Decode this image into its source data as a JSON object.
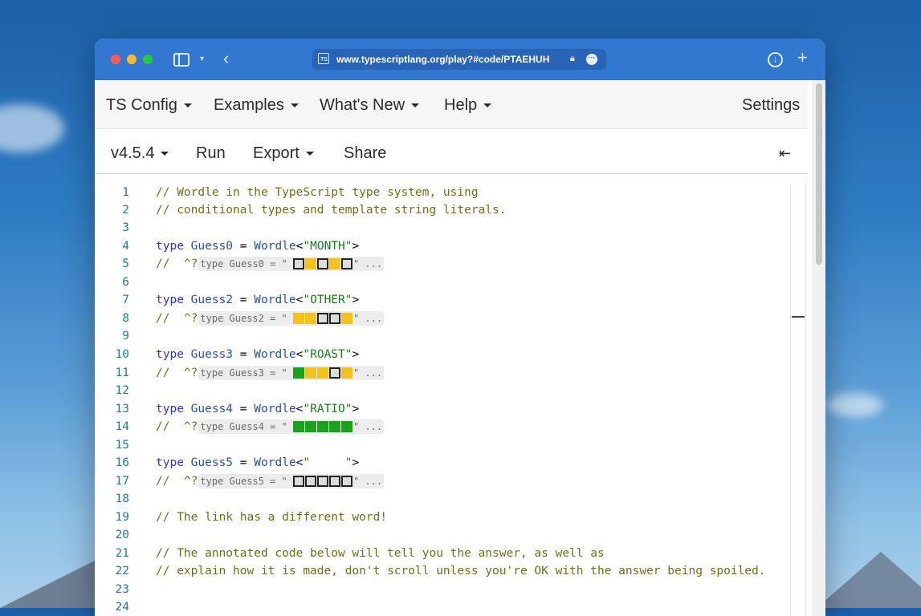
{
  "browser": {
    "url": "www.typescriptlang.org/play?#code/PTAEHUH",
    "favicon_text": "TS",
    "icons": [
      "sidebar-icon",
      "chevron-down-icon",
      "back-icon",
      "lock-icon",
      "more-icon",
      "download-icon",
      "plus-icon"
    ]
  },
  "menu": {
    "ts_config": "TS Config",
    "examples": "Examples",
    "whats_new": "What's New",
    "help": "Help",
    "settings": "Settings"
  },
  "toolbar": {
    "version": "v4.5.4",
    "run": "Run",
    "export": "Export",
    "share": "Share",
    "collapse_glyph": "⇤"
  },
  "colors": {
    "titlebar": "#3378d0",
    "comment": "#67711c",
    "keyword": "#2a34cc",
    "string": "#1d7a1d",
    "square_yellow": "#f4c21f",
    "square_green": "#1aa31a"
  },
  "code": {
    "l1": "// Wordle in the TypeScript type system, using",
    "l2": "// conditional types and template string literals.",
    "type_kw": "type",
    "eq": " = ",
    "wordle": "Wordle",
    "hint_prefix": "//  ^?",
    "hint_quote": "\"",
    "hint_tail": "\" ...",
    "g0_name": "Guess0",
    "g0_word": "\"MONTH\"",
    "g0_hint": "type Guess0 = \" ",
    "g0_squares": [
      "grey",
      "yellow",
      "grey",
      "yellow",
      "grey"
    ],
    "g2_name": "Guess2",
    "g2_word": "\"OTHER\"",
    "g2_hint": "type Guess2 = \" ",
    "g2_squares": [
      "yellow",
      "yellow",
      "grey",
      "grey",
      "yellow"
    ],
    "g3_name": "Guess3",
    "g3_word": "\"ROAST\"",
    "g3_hint": "type Guess3 = \" ",
    "g3_squares": [
      "green",
      "yellow",
      "yellow",
      "grey",
      "yellow"
    ],
    "g4_name": "Guess4",
    "g4_word": "\"RATIO\"",
    "g4_hint": "type Guess4 = \" ",
    "g4_squares": [
      "green",
      "green",
      "green",
      "green",
      "green"
    ],
    "g5_name": "Guess5",
    "g5_word": "\"     \"",
    "g5_hint": "type Guess5 = \" ",
    "g5_squares": [
      "grey",
      "grey",
      "grey",
      "grey",
      "grey"
    ],
    "l19": "// The link has a different word!",
    "l21": "// The annotated code below will tell you the answer, as well as",
    "l22": "// explain how it is made, don't scroll unless you're OK with the answer being spoiled."
  },
  "line_numbers": [
    "1",
    "2",
    "3",
    "4",
    "5",
    "6",
    "7",
    "8",
    "9",
    "10",
    "11",
    "12",
    "13",
    "14",
    "15",
    "16",
    "17",
    "18",
    "19",
    "20",
    "21",
    "22",
    "23",
    "24"
  ]
}
